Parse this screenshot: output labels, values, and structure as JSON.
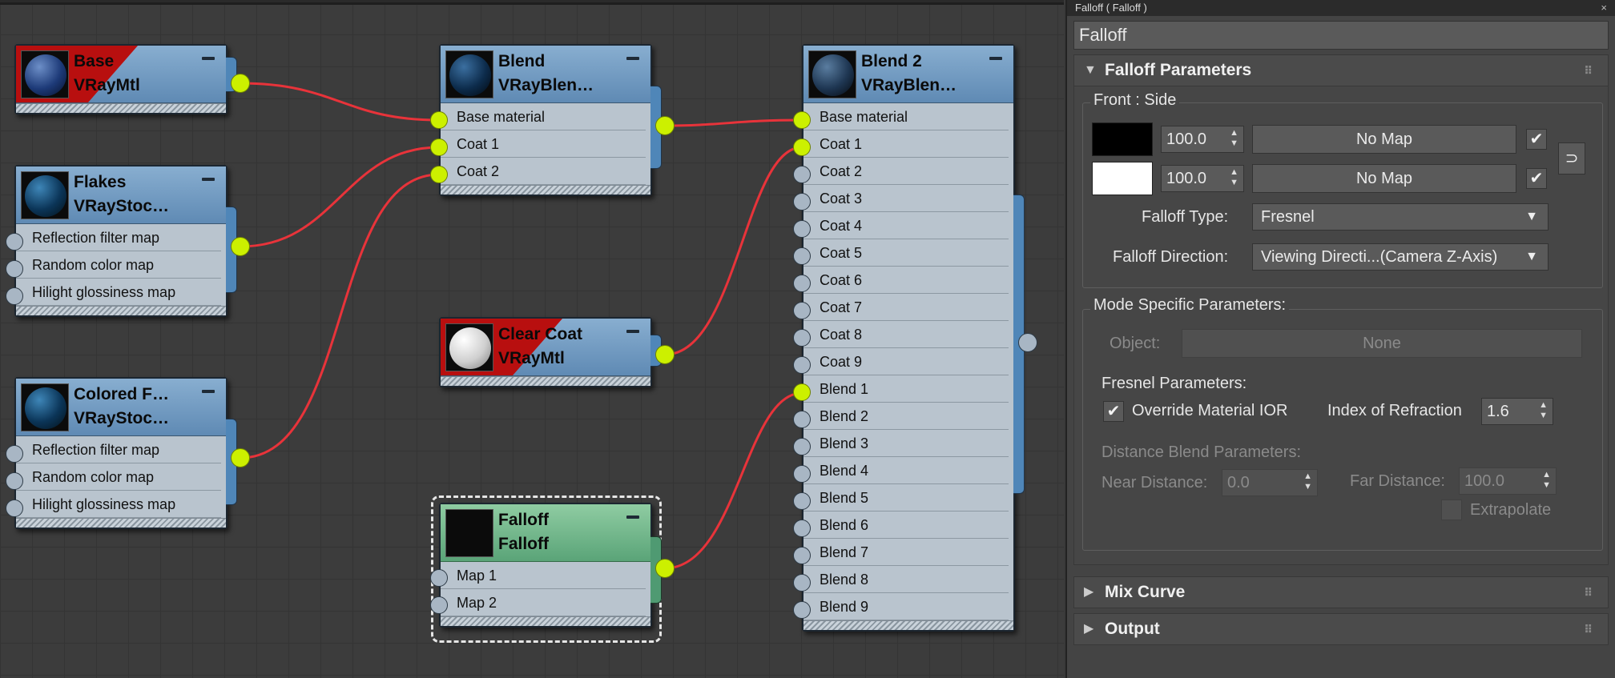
{
  "nodes": {
    "base": {
      "title": "Base",
      "subtitle": "VRayMtl"
    },
    "flakes": {
      "title": "Flakes",
      "subtitle": "VRayStoc…",
      "rows": [
        "Reflection filter map",
        "Random color map",
        "Hilight glossiness map"
      ]
    },
    "colored": {
      "title": "Colored F…",
      "subtitle": "VRayStoc…",
      "rows": [
        "Reflection filter map",
        "Random color map",
        "Hilight glossiness map"
      ]
    },
    "blend": {
      "title": "Blend",
      "subtitle": "VRayBlen…",
      "rows": [
        "Base material",
        "Coat 1",
        "Coat 2"
      ]
    },
    "clearcoat": {
      "title": "Clear Coat",
      "subtitle": "VRayMtl"
    },
    "falloff": {
      "title": "Falloff",
      "subtitle": "Falloff",
      "rows": [
        "Map 1",
        "Map 2"
      ]
    },
    "blend2": {
      "title": "Blend 2",
      "subtitle": "VRayBlen…",
      "rows": [
        "Base material",
        "Coat 1",
        "Coat 2",
        "Coat 3",
        "Coat 4",
        "Coat 5",
        "Coat 6",
        "Coat 7",
        "Coat 8",
        "Coat 9",
        "Blend 1",
        "Blend 2",
        "Blend 3",
        "Blend 4",
        "Blend 5",
        "Blend 6",
        "Blend 7",
        "Blend 8",
        "Blend 9"
      ]
    }
  },
  "panel": {
    "window_title": "Falloff  ( Falloff )",
    "close": "×",
    "name": "Falloff",
    "rollouts": {
      "params": "Falloff Parameters",
      "mix": "Mix Curve",
      "output": "Output"
    },
    "front_side": {
      "label": "Front : Side",
      "front_value": "100.0",
      "side_value": "100.0",
      "front_map": "No Map",
      "side_map": "No Map",
      "check": "✔",
      "swap": "⊃"
    },
    "falloff_type": {
      "label": "Falloff Type:",
      "value": "Fresnel"
    },
    "falloff_direction": {
      "label": "Falloff Direction:",
      "value": "Viewing Directi...(Camera Z-Axis)"
    },
    "mode_specific": {
      "label": "Mode Specific Parameters:",
      "object_label": "Object:",
      "object_value": "None",
      "fresnel_label": "Fresnel Parameters:",
      "override_label": "Override Material IOR",
      "ior_label": "Index of Refraction",
      "ior_value": "1.6",
      "distance_label": "Distance Blend Parameters:",
      "near_label": "Near Distance:",
      "near_value": "0.0",
      "far_label": "Far Distance:",
      "far_value": "100.0",
      "extrapolate_label": "Extrapolate"
    }
  },
  "colors": {
    "wire": "#e8333a",
    "port_on": "#ccf000",
    "header_blue": "#6f98c0",
    "header_green": "#6bb384",
    "material_red": "#b80f0f"
  }
}
